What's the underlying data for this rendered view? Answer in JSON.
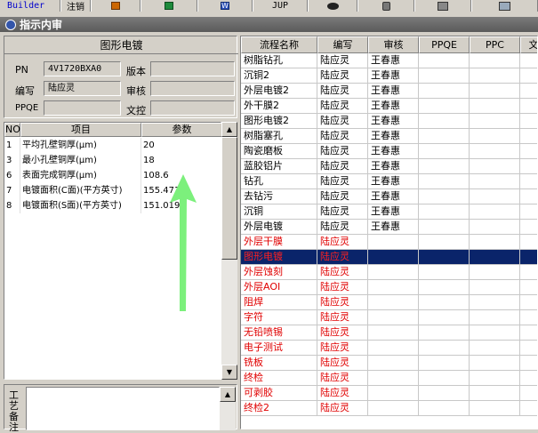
{
  "toolbar": {
    "builder_label": "Builder",
    "cancel_label": "注销",
    "jump_label": "JUP",
    "icons": [
      "powerpoint-icon",
      "excel-icon",
      "word-icon",
      "eye-icon",
      "database-icon",
      "network-icon",
      "monitor-icon"
    ]
  },
  "window": {
    "title": "指示内审"
  },
  "info": {
    "panel_title": "图形电镀",
    "pn_label": "PN",
    "pn_value": "4V1720BXA0",
    "version_label": "版本",
    "version_value": "",
    "editor_label": "编写",
    "editor_value": "陆应灵",
    "review_label": "审核",
    "review_value": "",
    "ppqe_label": "PPQE",
    "ppqe_value": "",
    "doc_label": "文控",
    "doc_value": ""
  },
  "params": {
    "headers": {
      "no": "NO",
      "item": "项目",
      "value": "参数"
    },
    "rows": [
      {
        "no": "1",
        "item": "平均孔壁铜厚(μm)",
        "value": "20"
      },
      {
        "no": "3",
        "item": "最小孔壁铜厚(μm)",
        "value": "18"
      },
      {
        "no": "6",
        "item": "表面完成铜厚(μm)",
        "value": "108.6"
      },
      {
        "no": "7",
        "item": "电镀面积(C面)(平方英寸)",
        "value": "155.471"
      },
      {
        "no": "8",
        "item": "电镀面积(S面)(平方英寸)",
        "value": "151.019"
      }
    ]
  },
  "memo": {
    "label": "工艺备注"
  },
  "grid": {
    "headers": {
      "name": "流程名称",
      "editor": "编写",
      "review": "审核",
      "ppqe": "PPQE",
      "ppc": "PPC",
      "doc": "文"
    },
    "rows": [
      {
        "name": "树脂钻孔",
        "editor": "陆应灵",
        "review": "王春惠",
        "status": "done"
      },
      {
        "name": "沉铜2",
        "editor": "陆应灵",
        "review": "王春惠",
        "status": "done"
      },
      {
        "name": "外层电镀2",
        "editor": "陆应灵",
        "review": "王春惠",
        "status": "done"
      },
      {
        "name": "外干膜2",
        "editor": "陆应灵",
        "review": "王春惠",
        "status": "done"
      },
      {
        "name": "图形电镀2",
        "editor": "陆应灵",
        "review": "王春惠",
        "status": "done"
      },
      {
        "name": "树脂塞孔",
        "editor": "陆应灵",
        "review": "王春惠",
        "status": "done"
      },
      {
        "name": "陶瓷磨板",
        "editor": "陆应灵",
        "review": "王春惠",
        "status": "done"
      },
      {
        "name": "蓝胶铝片",
        "editor": "陆应灵",
        "review": "王春惠",
        "status": "done"
      },
      {
        "name": "钻孔",
        "editor": "陆应灵",
        "review": "王春惠",
        "status": "done"
      },
      {
        "name": "去钻污",
        "editor": "陆应灵",
        "review": "王春惠",
        "status": "done"
      },
      {
        "name": "沉铜",
        "editor": "陆应灵",
        "review": "王春惠",
        "status": "done"
      },
      {
        "name": "外层电镀",
        "editor": "陆应灵",
        "review": "王春惠",
        "status": "done"
      },
      {
        "name": "外层干膜",
        "editor": "陆应灵",
        "review": "",
        "status": "pending"
      },
      {
        "name": "图形电镀",
        "editor": "陆应灵",
        "review": "",
        "status": "selected"
      },
      {
        "name": "外层蚀刻",
        "editor": "陆应灵",
        "review": "",
        "status": "pending"
      },
      {
        "name": "外层AOI",
        "editor": "陆应灵",
        "review": "",
        "status": "pending"
      },
      {
        "name": "阻焊",
        "editor": "陆应灵",
        "review": "",
        "status": "pending"
      },
      {
        "name": "字符",
        "editor": "陆应灵",
        "review": "",
        "status": "pending"
      },
      {
        "name": "无铅喷锡",
        "editor": "陆应灵",
        "review": "",
        "status": "pending"
      },
      {
        "name": "电子测试",
        "editor": "陆应灵",
        "review": "",
        "status": "pending"
      },
      {
        "name": "铣板",
        "editor": "陆应灵",
        "review": "",
        "status": "pending"
      },
      {
        "name": "终检",
        "editor": "陆应灵",
        "review": "",
        "status": "pending"
      },
      {
        "name": "可剥胶",
        "editor": "陆应灵",
        "review": "",
        "status": "pending"
      },
      {
        "name": "终检2",
        "editor": "陆应灵",
        "review": "",
        "status": "pending"
      }
    ]
  },
  "colors": {
    "pending_text": "#e00000",
    "selected_bg": "#0a246a",
    "arrow": "#7cf07c"
  }
}
